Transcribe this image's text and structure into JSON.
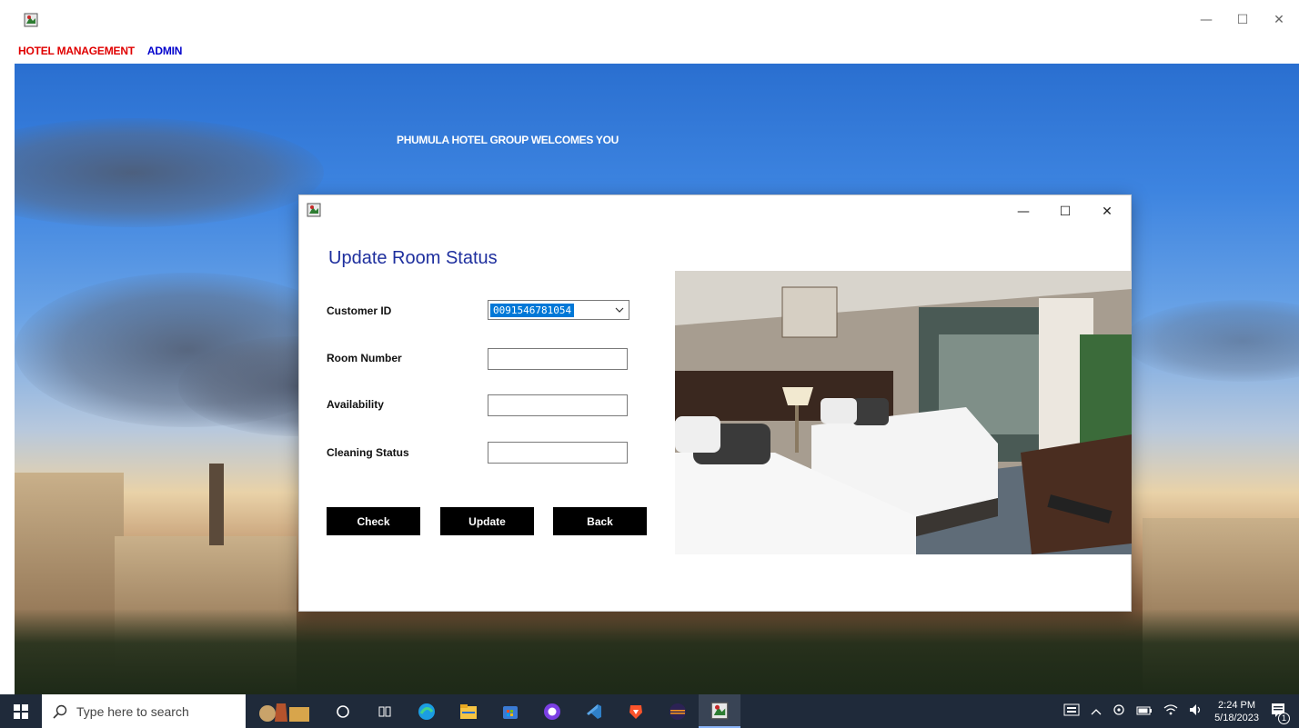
{
  "main_window": {
    "menu": {
      "hotel_management": "HOTEL MANAGEMENT",
      "admin": "ADMIN"
    },
    "controls": {
      "minimize": "—",
      "maximize": "☐",
      "close": "✕"
    },
    "welcome_text": "PHUMULA HOTEL GROUP WELCOMES YOU"
  },
  "dialog": {
    "title": "Update Room Status",
    "controls": {
      "minimize": "—",
      "maximize": "☐",
      "close": "✕"
    },
    "fields": {
      "customer_id_label": "Customer ID",
      "customer_id_value": "0091546781054",
      "room_number_label": "Room Number",
      "availability_label": "Availability",
      "cleaning_status_label": "Cleaning Status"
    },
    "buttons": {
      "check": "Check",
      "update": "Update",
      "back": "Back"
    }
  },
  "taskbar": {
    "search_placeholder": "Type here to search",
    "clock_time": "2:24 PM",
    "clock_date": "5/18/2023",
    "notification_count": "1"
  },
  "colors": {
    "menu_red": "#e00000",
    "menu_blue": "#0000cc",
    "dialog_title": "#1e2f9e",
    "button_bg": "#000000",
    "taskbar_bg": "#1f2a3a"
  }
}
